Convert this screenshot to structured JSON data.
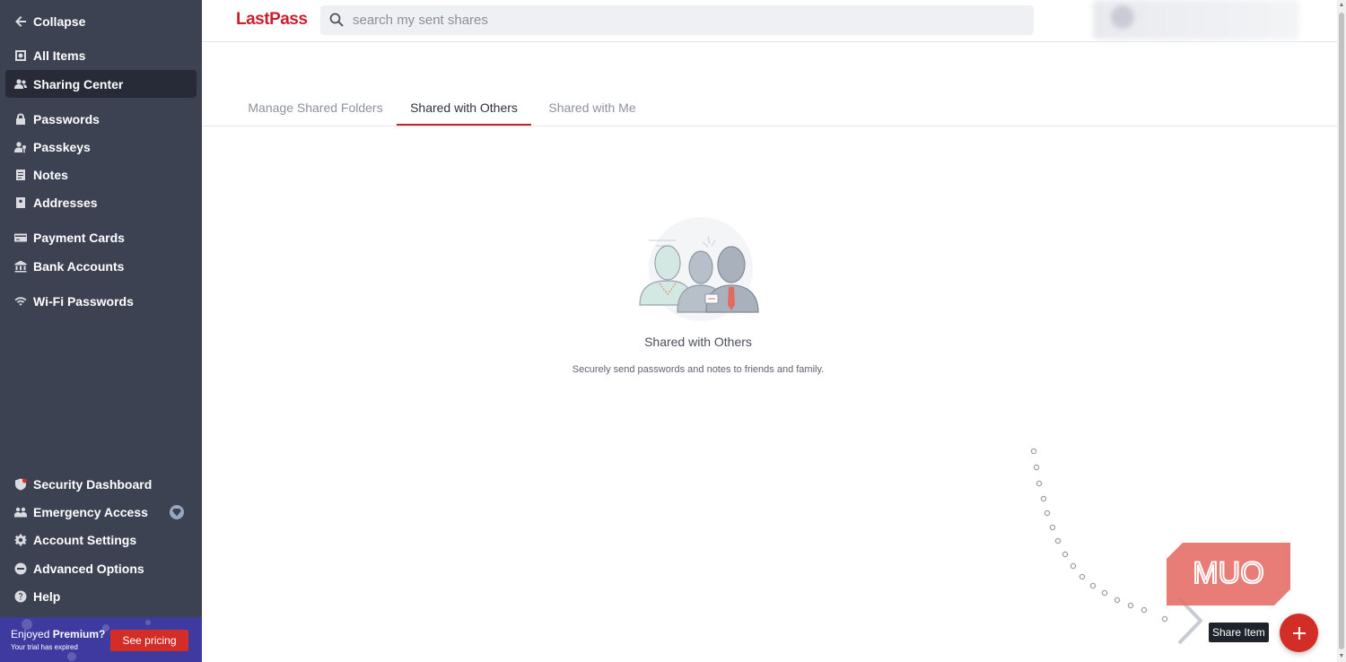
{
  "sidebar": {
    "collapse": {
      "label": "Collapse",
      "icon": "arrow-left-icon"
    },
    "items": [
      {
        "label": "All Items",
        "icon": "vault-icon"
      },
      {
        "label": "Sharing Center",
        "icon": "people-icon",
        "active": true
      },
      {
        "label": "Passwords",
        "icon": "lock-icon"
      },
      {
        "label": "Passkeys",
        "icon": "passkey-icon"
      },
      {
        "label": "Notes",
        "icon": "note-icon"
      },
      {
        "label": "Addresses",
        "icon": "address-icon"
      },
      {
        "label": "Payment Cards",
        "icon": "card-icon"
      },
      {
        "label": "Bank Accounts",
        "icon": "bank-icon"
      },
      {
        "label": "Wi-Fi Passwords",
        "icon": "wifi-icon"
      }
    ],
    "bottom_items": [
      {
        "label": "Security Dashboard",
        "icon": "shield-icon"
      },
      {
        "label": "Emergency Access",
        "icon": "emergency-access-icon",
        "badge": "diamond-icon"
      },
      {
        "label": "Account Settings",
        "icon": "gear-icon"
      },
      {
        "label": "Advanced Options",
        "icon": "advanced-icon"
      },
      {
        "label": "Help",
        "icon": "help-icon"
      }
    ],
    "promo": {
      "prefix": "Enjoyed ",
      "bold": "Premium?",
      "subtitle": "Your trial has expired",
      "button": "See pricing"
    }
  },
  "header": {
    "logo": "LastPass",
    "search_placeholder": "search my sent shares"
  },
  "tabs": [
    {
      "label": "Manage Shared Folders",
      "active": false
    },
    {
      "label": "Shared with Others",
      "active": true
    },
    {
      "label": "Shared with Me",
      "active": false
    }
  ],
  "empty_state": {
    "title": "Shared with Others",
    "subtitle": "Securely send passwords and notes to friends and family."
  },
  "fab": {
    "tooltip": "Share Item",
    "icon": "plus-icon"
  },
  "watermark": {
    "text": "MUO"
  },
  "colors": {
    "sidebar_bg": "#3c4252",
    "sidebar_active": "#262b37",
    "brand_red": "#c8202f",
    "promo_bg": "#3f3aa0",
    "button_red": "#d32d27"
  }
}
